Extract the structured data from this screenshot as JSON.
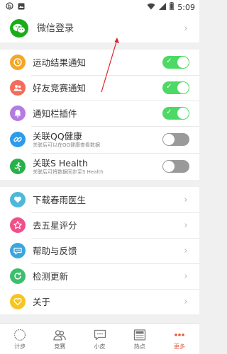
{
  "status_bar": {
    "time": "5:09"
  },
  "wechat": {
    "label": "微信登录"
  },
  "notifications": [
    {
      "label": "运动结果通知",
      "icon": "clock-icon",
      "color": "#f5a623",
      "toggle": "on"
    },
    {
      "label": "好友竞赛通知",
      "icon": "friends-icon",
      "color": "#f26d5b",
      "toggle": "on"
    },
    {
      "label": "通知栏插件",
      "icon": "bell-icon",
      "color": "#b57ce0",
      "toggle": "on"
    },
    {
      "label": "关联QQ健康",
      "sub": "关联后可以在QQ健康查看数据",
      "icon": "link-icon",
      "color": "#2e9be8",
      "toggle": "off"
    },
    {
      "label": "关联S Health",
      "sub": "关联后可将数据同步至S Health",
      "icon": "runner-icon",
      "color": "#25b24a",
      "toggle": "off"
    }
  ],
  "misc": [
    {
      "label": "下载春雨医生",
      "icon": "heart-icon",
      "color": "#4db8d8"
    },
    {
      "label": "去五星评分",
      "icon": "star-icon",
      "color": "#f0508a"
    },
    {
      "label": "帮助与反馈",
      "icon": "chat-icon",
      "color": "#3aa6e0"
    },
    {
      "label": "检测更新",
      "icon": "refresh-icon",
      "color": "#3cbf6b"
    },
    {
      "label": "关于",
      "icon": "heart-outline-icon",
      "color": "#f5c526"
    }
  ],
  "tabs": [
    {
      "label": "计步",
      "active": false
    },
    {
      "label": "竞赛",
      "active": false
    },
    {
      "label": "小皮",
      "active": false
    },
    {
      "label": "热点",
      "active": false
    },
    {
      "label": "更多",
      "active": true
    }
  ],
  "colors": {
    "toggle_on": "#4cd964",
    "toggle_off": "#9a9a9a",
    "active_tab": "#e9573f",
    "wechat": "#1aad19"
  }
}
